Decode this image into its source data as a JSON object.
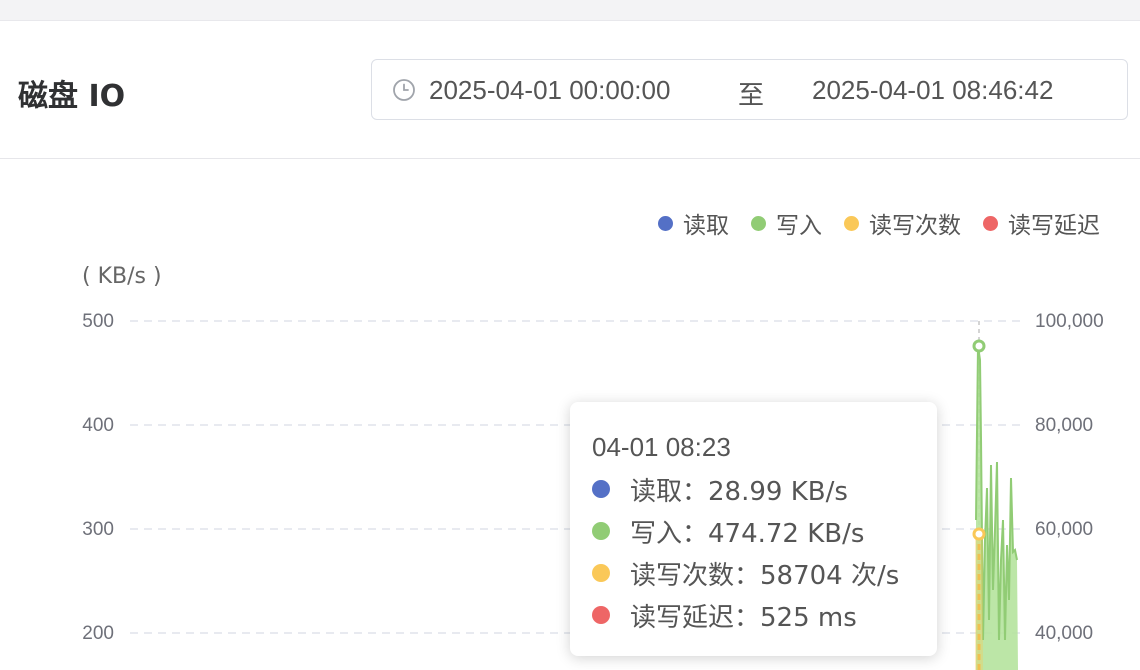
{
  "panel": {
    "title": "磁盘 IO",
    "time_range": {
      "start": "2025-04-01 00:00:00",
      "separator": "至",
      "end": "2025-04-01 08:46:42",
      "icon": "clock-icon"
    }
  },
  "legend": [
    {
      "name": "读取",
      "color": "#5470c6"
    },
    {
      "name": "写入",
      "color": "#91cc75"
    },
    {
      "name": "读写次数",
      "color": "#fac858"
    },
    {
      "name": "读写延迟",
      "color": "#ee6666"
    }
  ],
  "axes": {
    "left_unit": "( KB/s )",
    "left_ticks": [
      "500",
      "400",
      "300",
      "200"
    ],
    "right_ticks": [
      "100,000",
      "80,000",
      "60,000",
      "40,000"
    ]
  },
  "tooltip": {
    "time": "04-01 08:23",
    "rows": [
      {
        "label": "读取：28.99 KB/s",
        "color": "#5470c6"
      },
      {
        "label": "写入：474.72 KB/s",
        "color": "#91cc75"
      },
      {
        "label": "读写次数：58704 次/s",
        "color": "#fac858"
      },
      {
        "label": "读写延迟：525 ms",
        "color": "#ee6666"
      }
    ]
  },
  "chart_data": {
    "type": "line",
    "ylim_left": [
      0,
      500
    ],
    "ylim_right": [
      0,
      100000
    ],
    "series": [
      {
        "name": "写入",
        "axis": "left",
        "values": [
          474.72,
          380,
          340,
          360,
          300,
          340,
          350,
          360,
          310,
          300,
          340,
          310,
          300
        ]
      },
      {
        "name": "读写次数",
        "axis": "right",
        "values": [
          58704,
          58704
        ]
      }
    ]
  }
}
